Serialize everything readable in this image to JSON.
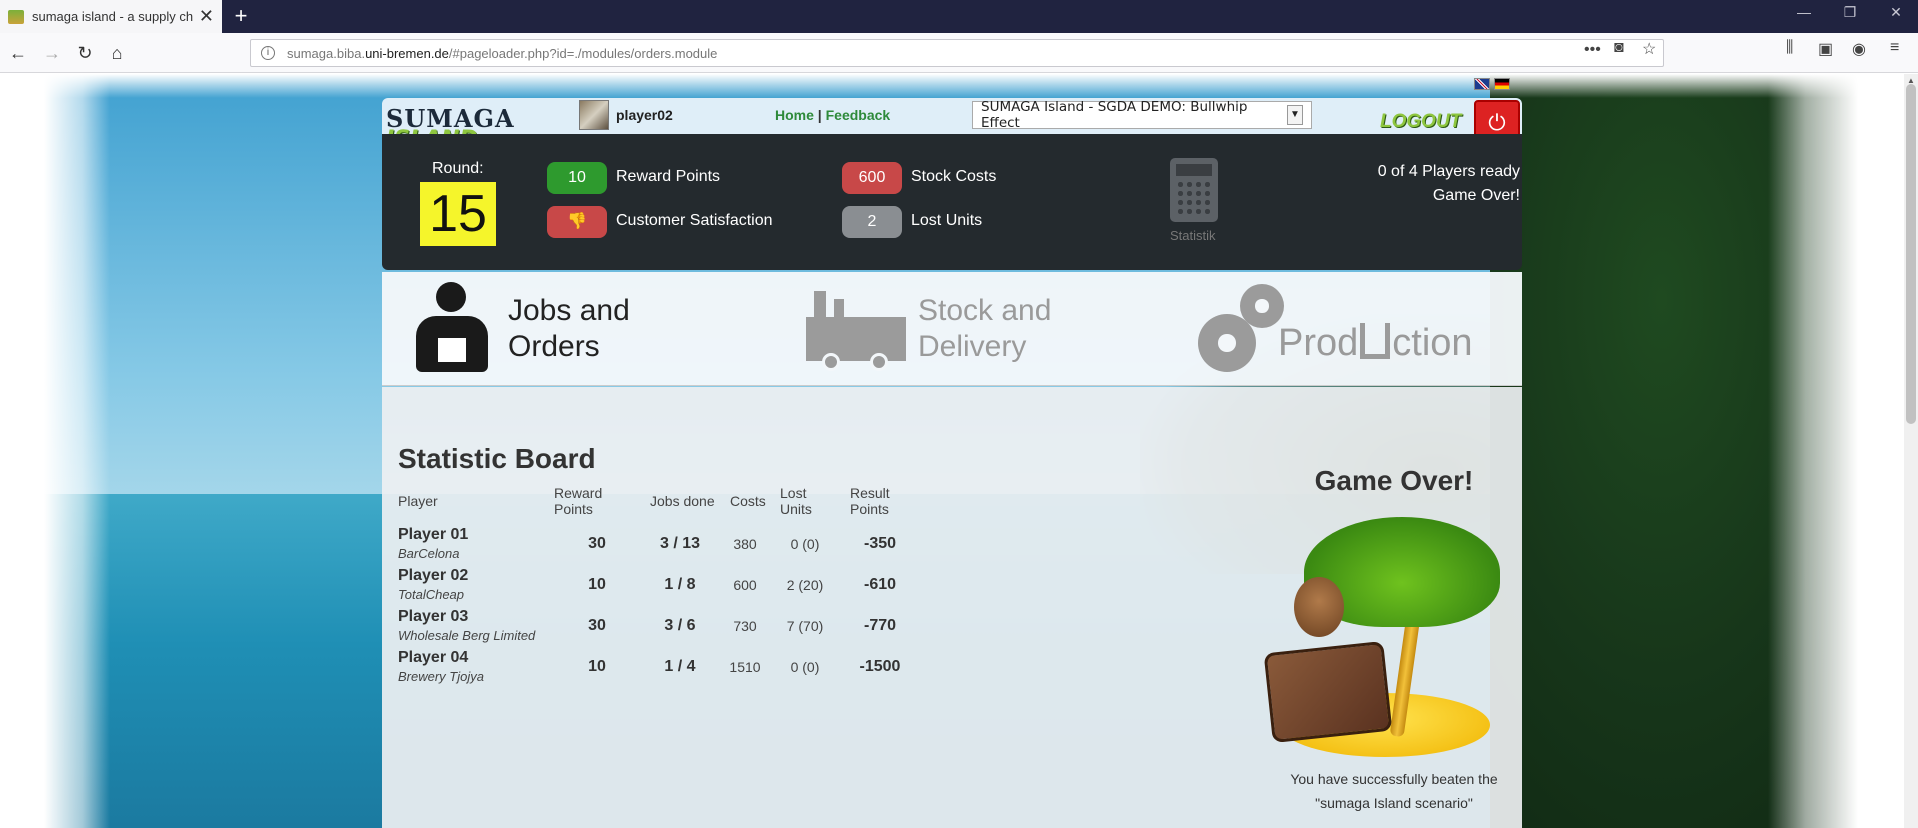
{
  "browser": {
    "tab_title": "sumaga island - a supply chain",
    "url_prefix": "sumaga.biba.",
    "url_host": "uni-bremen.de",
    "url_path": "/#pageloader.php?id=./modules/orders.module"
  },
  "header": {
    "logo_top": "SUMAGA",
    "logo_bottom": "ISLAND",
    "username": "player02",
    "home_link": "Home",
    "separator": "|",
    "feedback_link": "Feedback",
    "scenario_selected": "SUMAGA Island - SGDA DEMO: Bullwhip Effect",
    "logout_label": "LOGOUT"
  },
  "status": {
    "round_label": "Round:",
    "round_value": "15",
    "reward_points_value": "10",
    "reward_points_label": "Reward Points",
    "customer_satisfaction_label": "Customer Satisfaction",
    "stock_costs_value": "600",
    "stock_costs_label": "Stock Costs",
    "lost_units_value": "2",
    "lost_units_label": "Lost Units",
    "statistik_label": "Statistik",
    "players_ready": "0 of 4 Players ready",
    "game_state": "Game Over!"
  },
  "nav": {
    "jobs_line1": "Jobs and",
    "jobs_line2": "Orders",
    "stock_line1": "Stock and",
    "stock_line2": "Delivery",
    "production_a": "Prod",
    "production_b": "ction"
  },
  "statistic_board": {
    "title": "Statistic Board",
    "columns": [
      "Player",
      "Reward Points",
      "Jobs done",
      "Costs",
      "Lost Units",
      "Result Points"
    ],
    "rows": [
      {
        "player": "Player 01",
        "company": "BarCelona",
        "reward": "30",
        "jobs": "3 / 13",
        "costs": "380",
        "lost": "0 (0)",
        "result": "-350"
      },
      {
        "player": "Player 02",
        "company": "TotalCheap",
        "reward": "10",
        "jobs": "1 / 8",
        "costs": "600",
        "lost": "2 (20)",
        "result": "-610"
      },
      {
        "player": "Player 03",
        "company": "Wholesale Berg Limited",
        "reward": "30",
        "jobs": "3 / 6",
        "costs": "730",
        "lost": "7 (70)",
        "result": "-770"
      },
      {
        "player": "Player 04",
        "company": "Brewery Tjojya",
        "reward": "10",
        "jobs": "1 / 4",
        "costs": "1510",
        "lost": "0 (0)",
        "result": "-1500"
      }
    ]
  },
  "gameover": {
    "title": "Game Over!",
    "line1": "You have successfully beaten the",
    "line2": "\"sumaga Island scenario\""
  },
  "colors": {
    "green_badge": "#2e9a2e",
    "red_badge": "#c84848",
    "grey_badge": "#8a8e92",
    "round_box": "#f5f52b",
    "link_green": "#2e8a3a"
  }
}
